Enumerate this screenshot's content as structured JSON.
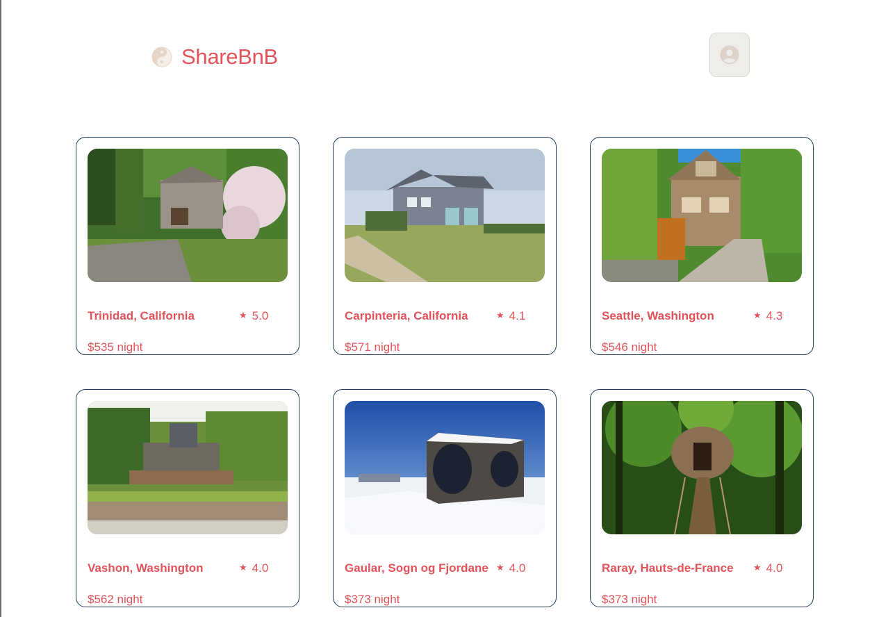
{
  "header": {
    "brand": "ShareBnB",
    "logo_icon": "yin-yang-icon",
    "profile_icon": "user-circle-icon"
  },
  "colors": {
    "accent": "#e2535a",
    "card_border": "#1f3b5e",
    "logo_icon": "#e6d6c9",
    "profile_bg": "#efedea"
  },
  "listings": [
    {
      "location": "Trinidad, California",
      "rating": "5.0",
      "price": "$535 night",
      "star_icon": "star-icon"
    },
    {
      "location": "Carpinteria, California",
      "rating": "4.1",
      "price": "$571 night",
      "star_icon": "star-icon"
    },
    {
      "location": "Seattle, Washington",
      "rating": "4.3",
      "price": "$546 night",
      "star_icon": "star-icon"
    },
    {
      "location": "Vashon, Washington",
      "rating": "4.0",
      "price": "$562 night",
      "star_icon": "star-icon"
    },
    {
      "location": "Gaular, Sogn og Fjordane",
      "rating": "4.0",
      "price": "$373 night",
      "star_icon": "star-icon"
    },
    {
      "location": "Raray, Hauts-de-France",
      "rating": "4.0",
      "price": "$373 night",
      "star_icon": "star-icon"
    }
  ]
}
